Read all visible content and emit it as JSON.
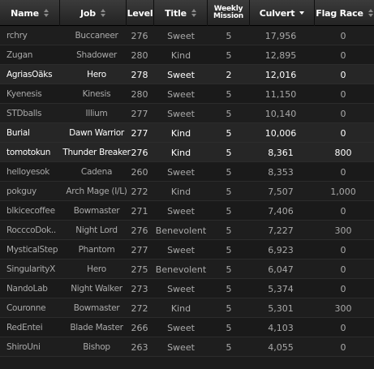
{
  "table": {
    "columns": {
      "name": "Name",
      "job": "Job",
      "level": "Level",
      "title": "Title",
      "weekly_line1": "Weekly",
      "weekly_line2": "Mission",
      "culvert": "Culvert",
      "flag_race": "Flag Race"
    },
    "sort_column": "Culvert",
    "sort_direction": "descending",
    "rows": [
      {
        "name": "rchry",
        "job": "Buccaneer",
        "level": "276",
        "title": "Sweet",
        "weekly": "5",
        "culvert": "17,956",
        "flag": "0",
        "highlight": false
      },
      {
        "name": "Zugan",
        "job": "Shadower",
        "level": "280",
        "title": "Kind",
        "weekly": "5",
        "culvert": "12,895",
        "flag": "0",
        "highlight": false
      },
      {
        "name": "AgriasOäks",
        "job": "Hero",
        "level": "278",
        "title": "Sweet",
        "weekly": "2",
        "culvert": "12,016",
        "flag": "0",
        "highlight": true
      },
      {
        "name": "Kyenesis",
        "job": "Kinesis",
        "level": "280",
        "title": "Sweet",
        "weekly": "5",
        "culvert": "11,150",
        "flag": "0",
        "highlight": false
      },
      {
        "name": "STDballs",
        "job": "Illium",
        "level": "277",
        "title": "Sweet",
        "weekly": "5",
        "culvert": "10,140",
        "flag": "0",
        "highlight": false
      },
      {
        "name": "Burial",
        "job": "Dawn Warrior",
        "level": "277",
        "title": "Kind",
        "weekly": "5",
        "culvert": "10,006",
        "flag": "0",
        "highlight": true
      },
      {
        "name": "tomotokun",
        "job": "Thunder Breaker",
        "level": "276",
        "title": "Kind",
        "weekly": "5",
        "culvert": "8,361",
        "flag": "800",
        "highlight": true
      },
      {
        "name": "helloyesok",
        "job": "Cadena",
        "level": "260",
        "title": "Sweet",
        "weekly": "5",
        "culvert": "8,353",
        "flag": "0",
        "highlight": false
      },
      {
        "name": "pokguy",
        "job": "Arch Mage (I/L)",
        "level": "272",
        "title": "Kind",
        "weekly": "5",
        "culvert": "7,507",
        "flag": "1,000",
        "highlight": false
      },
      {
        "name": "blkicecoffee",
        "job": "Bowmaster",
        "level": "271",
        "title": "Sweet",
        "weekly": "5",
        "culvert": "7,406",
        "flag": "0",
        "highlight": false
      },
      {
        "name": "RocccoDok..",
        "job": "Night Lord",
        "level": "276",
        "title": "Benevolent",
        "weekly": "5",
        "culvert": "7,227",
        "flag": "300",
        "highlight": false
      },
      {
        "name": "MysticalStep",
        "job": "Phantom",
        "level": "277",
        "title": "Sweet",
        "weekly": "5",
        "culvert": "6,923",
        "flag": "0",
        "highlight": false
      },
      {
        "name": "SingularityX",
        "job": "Hero",
        "level": "275",
        "title": "Benevolent",
        "weekly": "5",
        "culvert": "6,047",
        "flag": "0",
        "highlight": false
      },
      {
        "name": "NandoLab",
        "job": "Night Walker",
        "level": "273",
        "title": "Sweet",
        "weekly": "5",
        "culvert": "5,374",
        "flag": "0",
        "highlight": false
      },
      {
        "name": "Couronne",
        "job": "Bowmaster",
        "level": "272",
        "title": "Kind",
        "weekly": "5",
        "culvert": "5,301",
        "flag": "300",
        "highlight": false
      },
      {
        "name": "RedEntei",
        "job": "Blade Master",
        "level": "266",
        "title": "Sweet",
        "weekly": "5",
        "culvert": "4,103",
        "flag": "0",
        "highlight": false
      },
      {
        "name": "ShiroUni",
        "job": "Bishop",
        "level": "263",
        "title": "Sweet",
        "weekly": "5",
        "culvert": "4,055",
        "flag": "0",
        "highlight": false
      }
    ]
  }
}
